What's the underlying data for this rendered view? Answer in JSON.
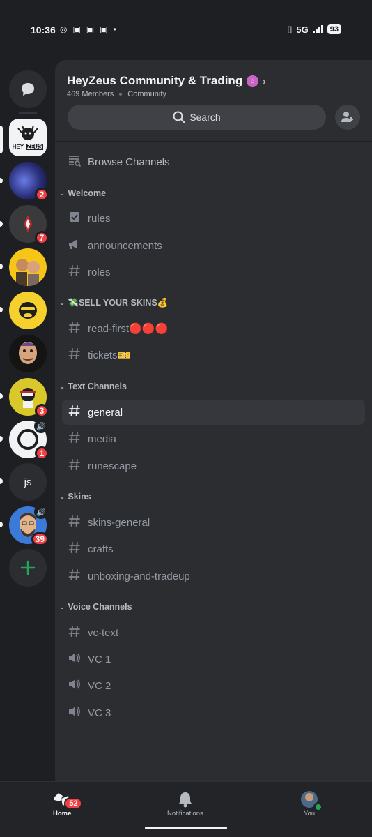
{
  "status": {
    "time": "10:36",
    "network": "5G",
    "battery": "93"
  },
  "server": {
    "name": "HeyZeus Community & Trading",
    "members": "469 Members",
    "type": "Community"
  },
  "search": {
    "label": "Search"
  },
  "browse_label": "Browse Channels",
  "rail": {
    "logo_line1": "HEY",
    "logo_line2": "ZEUS",
    "js_label": "js",
    "badges": [
      "2",
      "7",
      "3",
      "1",
      "39"
    ]
  },
  "categories": [
    {
      "name": "Welcome",
      "channels": [
        {
          "icon": "rules-icon",
          "name": "rules"
        },
        {
          "icon": "megaphone-icon",
          "name": "announcements"
        },
        {
          "icon": "hash-icon",
          "name": "roles"
        }
      ]
    },
    {
      "name": "💸SELL YOUR SKINS💰",
      "channels": [
        {
          "icon": "hash-icon",
          "name": "read-first🔴🔴🔴"
        },
        {
          "icon": "hash-icon",
          "name": "tickets🎫"
        }
      ]
    },
    {
      "name": "Text Channels",
      "channels": [
        {
          "icon": "hash-icon",
          "name": "general",
          "selected": true
        },
        {
          "icon": "hash-icon",
          "name": "media"
        },
        {
          "icon": "hash-icon",
          "name": "runescape"
        }
      ]
    },
    {
      "name": "Skins",
      "channels": [
        {
          "icon": "hash-icon",
          "name": "skins-general"
        },
        {
          "icon": "hash-icon",
          "name": "crafts"
        },
        {
          "icon": "hash-icon",
          "name": "unboxing-and-tradeup"
        }
      ]
    },
    {
      "name": "Voice Channels",
      "channels": [
        {
          "icon": "hash-icon",
          "name": "vc-text"
        },
        {
          "icon": "voice-icon",
          "name": "VC 1"
        },
        {
          "icon": "voice-icon",
          "name": "VC 2"
        },
        {
          "icon": "voice-icon",
          "name": "VC 3"
        }
      ]
    }
  ],
  "nav": {
    "home": "Home",
    "home_badge": "52",
    "notifications": "Notifications",
    "you": "You"
  },
  "colors": {
    "accent_red": "#f23f43",
    "selected_bg": "#35373c",
    "panel_bg": "#2b2d31"
  }
}
